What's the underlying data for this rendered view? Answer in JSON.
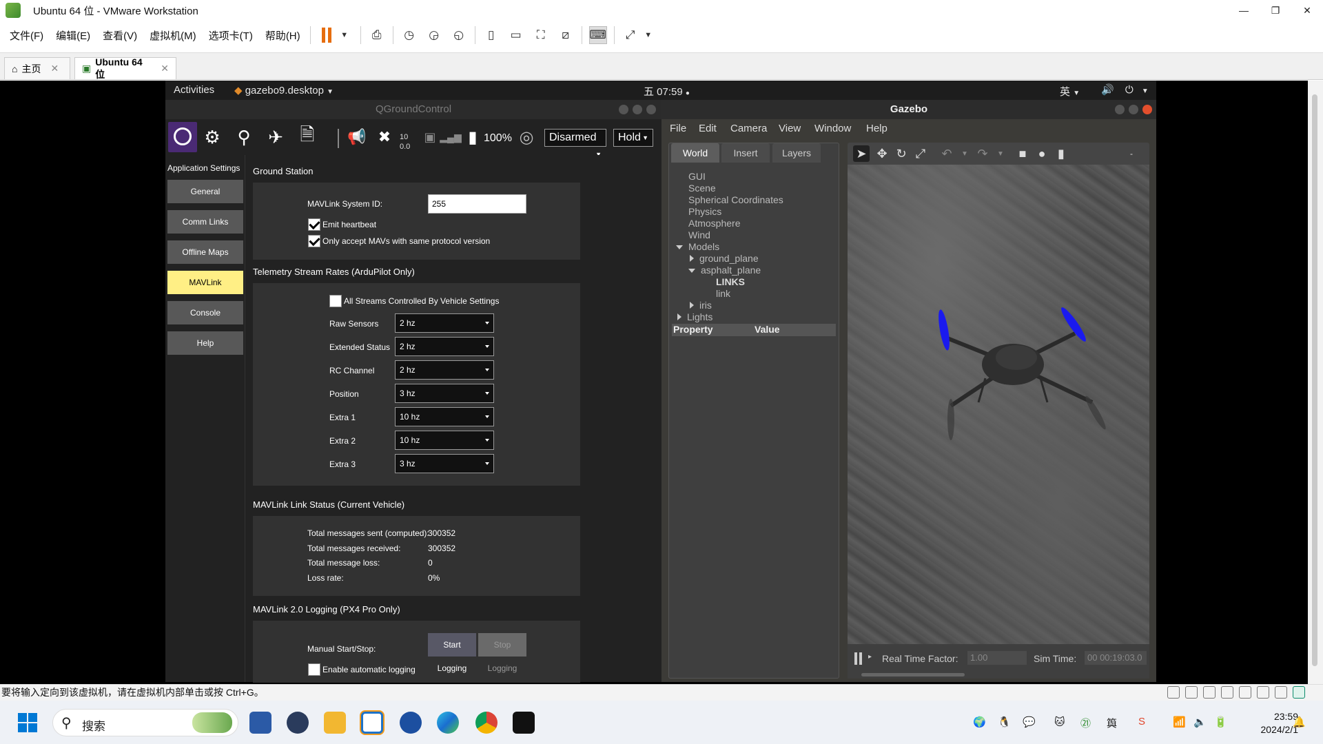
{
  "vmware": {
    "title": "Ubuntu 64 位 - VMware Workstation",
    "window_controls": [
      "—",
      "❐",
      "✕"
    ],
    "menus": [
      "文件(F)",
      "编辑(E)",
      "查看(V)",
      "虚拟机(M)",
      "选项卡(T)",
      "帮助(H)"
    ],
    "tabs": [
      {
        "label": "主页"
      },
      {
        "label": "Ubuntu 64 位"
      }
    ],
    "status_text": "要将输入定向到该虚拟机，请在虚拟机内部单击或按 Ctrl+G。"
  },
  "ubuntu": {
    "activities": "Activities",
    "app_name": "gazebo9.desktop",
    "clock": "五 07:59",
    "ime": "英"
  },
  "qgc": {
    "window_title": "QGroundControl",
    "toolbar": {
      "gps_count": "10",
      "gps_hdop": "0.0",
      "battery": "100%",
      "arm_state": "Disarmed",
      "flight_mode": "Hold"
    },
    "sidebar": {
      "header": "Application Settings",
      "items": [
        "General",
        "Comm Links",
        "Offline Maps",
        "MAVLink",
        "Console",
        "Help"
      ],
      "active": "MAVLink"
    },
    "ground_station": {
      "title": "Ground Station",
      "system_id_label": "MAVLink System ID:",
      "system_id_value": "255",
      "emit_heartbeat": "Emit heartbeat",
      "only_accept": "Only accept MAVs with same protocol version"
    },
    "telemetry": {
      "title": "Telemetry Stream Rates (ArduPilot Only)",
      "all_streams": "All Streams Controlled By Vehicle Settings",
      "rows": [
        {
          "label": "Raw Sensors",
          "value": "2 hz"
        },
        {
          "label": "Extended Status",
          "value": "2 hz"
        },
        {
          "label": "RC Channel",
          "value": "2 hz"
        },
        {
          "label": "Position",
          "value": "3 hz"
        },
        {
          "label": "Extra 1",
          "value": "10 hz"
        },
        {
          "label": "Extra 2",
          "value": "10 hz"
        },
        {
          "label": "Extra 3",
          "value": "3 hz"
        }
      ]
    },
    "link_status": {
      "title": "MAVLink Link Status (Current Vehicle)",
      "rows": [
        {
          "label": "Total messages sent (computed):",
          "value": "300352"
        },
        {
          "label": "Total messages received:",
          "value": "300352"
        },
        {
          "label": "Total message loss:",
          "value": "0"
        },
        {
          "label": "Loss rate:",
          "value": "0%"
        }
      ]
    },
    "logging": {
      "title": "MAVLink 2.0 Logging (PX4 Pro Only)",
      "manual_label": "Manual Start/Stop:",
      "start_button": "Start Logging",
      "stop_button": "Stop Logging",
      "auto_label": "Enable automatic logging"
    }
  },
  "gazebo": {
    "window_title": "Gazebo",
    "menus": [
      "File",
      "Edit",
      "Camera",
      "View",
      "Window",
      "Help"
    ],
    "tabs": [
      "World",
      "Insert",
      "Layers"
    ],
    "tree": [
      "GUI",
      "Scene",
      "Spherical Coordinates",
      "Physics",
      "Atmosphere",
      "Wind",
      "Models",
      "ground_plane",
      "asphalt_plane",
      "LINKS",
      "link",
      "iris",
      "Lights"
    ],
    "property_header": "Property",
    "value_header": "Value",
    "real_time_factor_label": "Real Time Factor:",
    "real_time_factor": "1.00",
    "sim_time_label": "Sim Time:",
    "sim_time": "00 00:19:03.0"
  },
  "taskbar": {
    "search_placeholder": "搜索",
    "time": "23:59",
    "date": "2024/2/1"
  }
}
